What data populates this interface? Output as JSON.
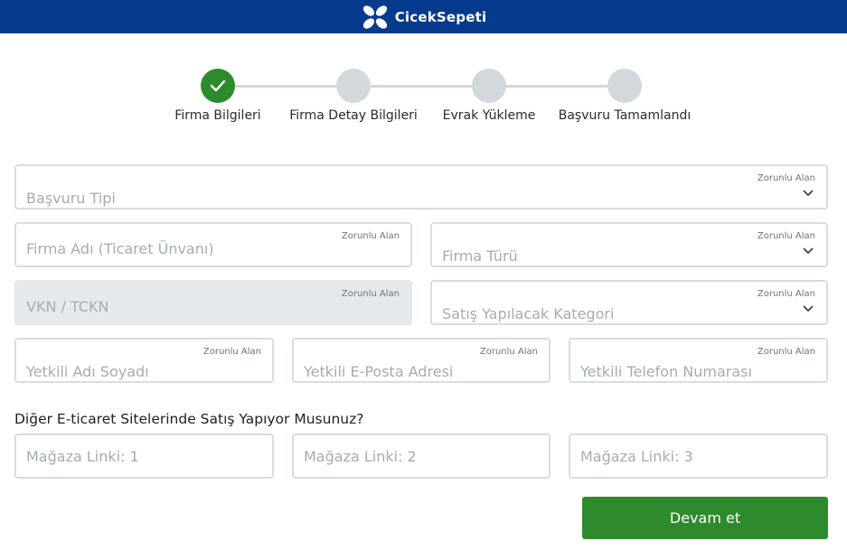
{
  "header": {
    "brand": "CicekSepeti"
  },
  "stepper": {
    "steps": [
      {
        "label": "Firma Bilgileri",
        "state": "done"
      },
      {
        "label": "Firma Detay Bilgileri",
        "state": "pending"
      },
      {
        "label": "Evrak Yükleme",
        "state": "pending"
      },
      {
        "label": "Başvuru Tamamlandı",
        "state": "pending"
      }
    ]
  },
  "form": {
    "required_label": "Zorunlu Alan",
    "basvuru_tipi": {
      "placeholder": "Başvuru Tipi",
      "value": ""
    },
    "firma_adi": {
      "placeholder": "Firma Adı (Ticaret Ünvanı)",
      "value": ""
    },
    "firma_turu": {
      "placeholder": "Firma Türü",
      "value": ""
    },
    "vkn": {
      "placeholder": "VKN / TCKN",
      "value": ""
    },
    "kategori": {
      "placeholder": "Satış Yapılacak Kategori",
      "value": ""
    },
    "yetkili_adi": {
      "placeholder": "Yetkili Adı Soyadı",
      "value": ""
    },
    "yetkili_eposta": {
      "placeholder": "Yetkili E-Posta Adresi",
      "value": ""
    },
    "yetkili_telefon": {
      "placeholder": "Yetkili Telefon Numarası",
      "value": ""
    },
    "question": "Diğer E-ticaret Sitelerinde Satış Yapıyor Musunuz?",
    "magaza1": {
      "placeholder": "Mağaza Linki: 1",
      "value": ""
    },
    "magaza2": {
      "placeholder": "Mağaza Linki: 2",
      "value": ""
    },
    "magaza3": {
      "placeholder": "Mağaza Linki: 3",
      "value": ""
    },
    "submit_label": "Devam et"
  },
  "colors": {
    "header_bg": "#063a8c",
    "accent_green": "#2e8b2d",
    "step_pending": "#d3d8dd"
  }
}
